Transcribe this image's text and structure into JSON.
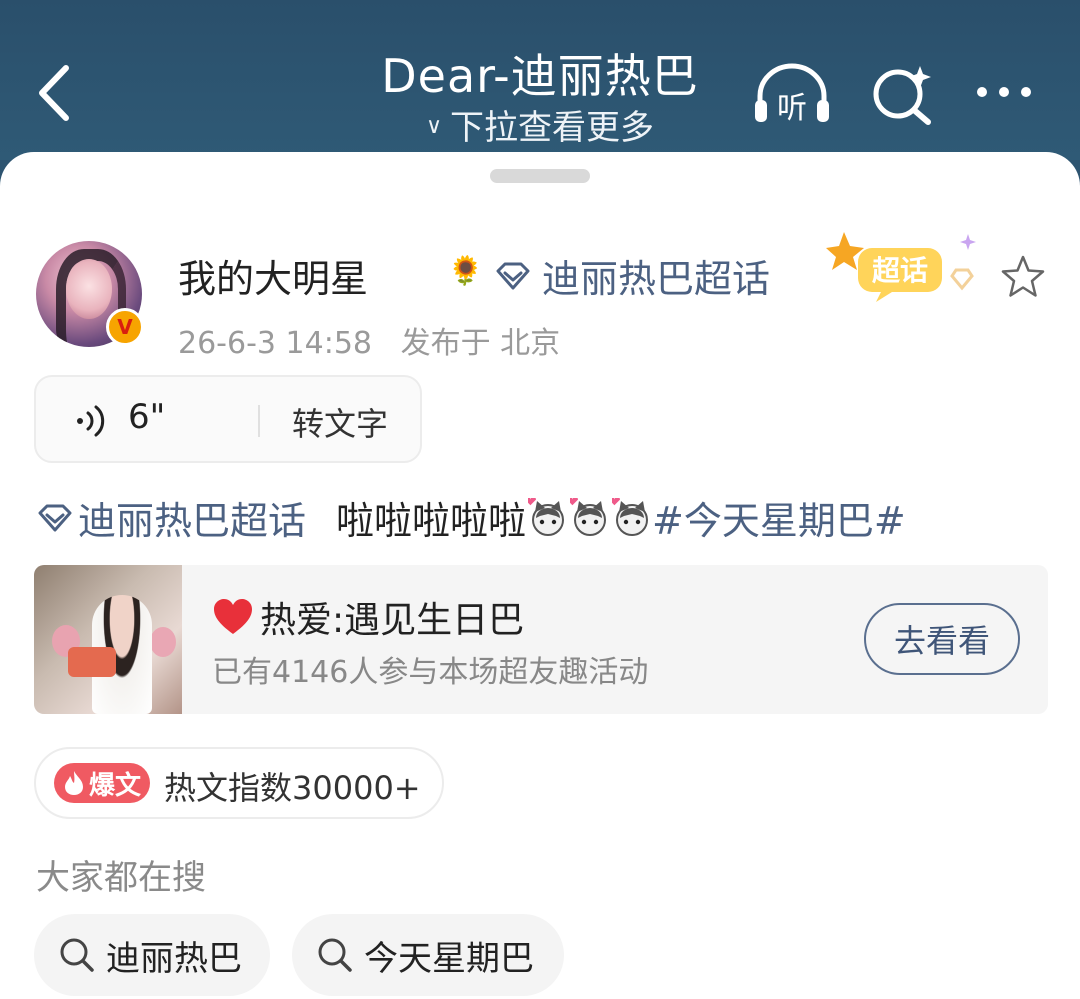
{
  "header": {
    "title": "Dear-迪丽热巴",
    "subtitle": "下拉查看更多",
    "listen_label": "听"
  },
  "post": {
    "username": "我的大明星",
    "topic": "迪丽热巴超话",
    "super_badge": "超话",
    "time": "26-6-3 14:58",
    "location": "发布于 北京",
    "voice": {
      "duration": "6\"",
      "convert_label": "转文字"
    },
    "body": {
      "topic": "迪丽热巴超话",
      "text": "啦啦啦啦啦",
      "hashtag": "#今天星期巴#"
    }
  },
  "activity": {
    "title": "热爱:遇见生日巴",
    "subtitle": "已有4146人参与本场超友趣活动",
    "button": "去看看"
  },
  "hot": {
    "badge": "爆文",
    "text": "热文指数30000+"
  },
  "search_section": {
    "label": "大家都在搜",
    "chips": [
      "迪丽热巴",
      "今天星期巴"
    ]
  },
  "colors": {
    "header_bg": "#2d5470",
    "link": "#4c6182",
    "hot_badge": "#f05a62"
  }
}
